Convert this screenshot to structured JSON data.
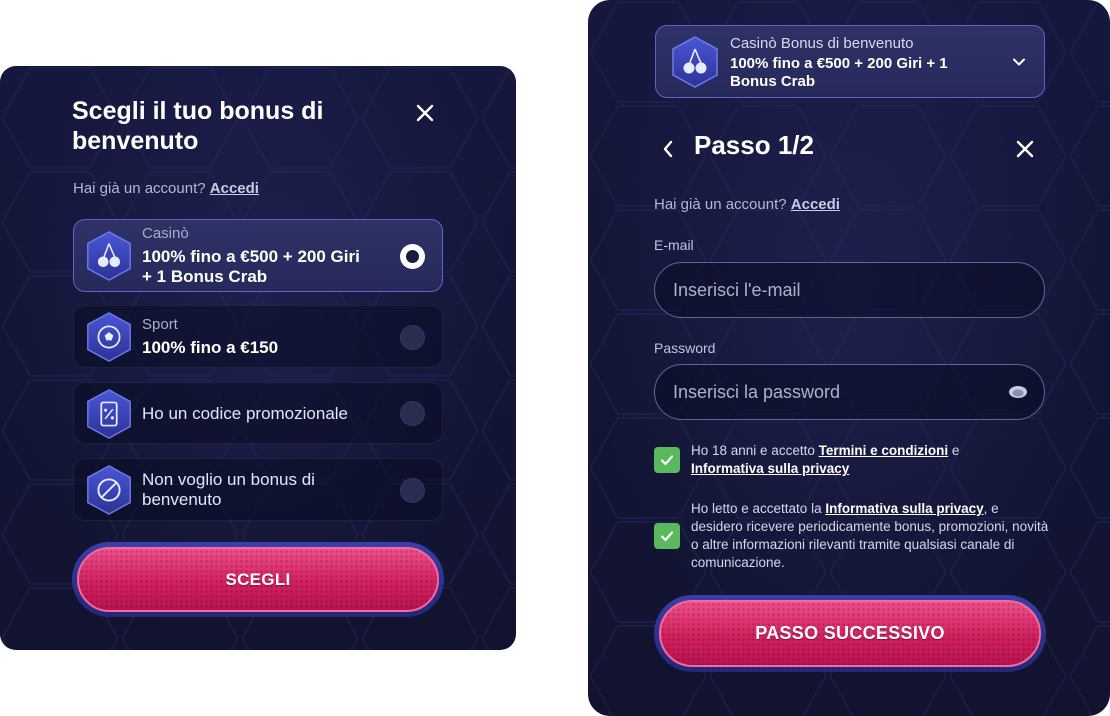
{
  "left": {
    "title": "Scegli il tuo bonus di benvenuto",
    "account_prompt": "Hai già un account?",
    "login_link": "Accedi",
    "options": [
      {
        "sub": "Casinò",
        "main": "100% fino a €500 + 200 Giri + 1 Bonus Crab",
        "icon": "cherry-icon",
        "selected": true
      },
      {
        "sub": "Sport",
        "main": "100% fino a €150",
        "icon": "soccer-ball-icon",
        "selected": false
      },
      {
        "text": "Ho un codice promozionale",
        "icon": "promo-code-icon",
        "selected": false
      },
      {
        "text": "Non voglio un bonus di benvenuto",
        "icon": "no-bonus-icon",
        "selected": false
      }
    ],
    "cta_label": "SCEGLI"
  },
  "right": {
    "bonus_selector": {
      "sub": "Casinò Bonus di benvenuto",
      "main": "100% fino a €500 + 200 Giri + 1 Bonus Crab"
    },
    "step_title": "Passo 1/2",
    "account_prompt": "Hai già un account?",
    "login_link": "Accedi",
    "email": {
      "label": "E-mail",
      "placeholder": "Inserisci l'e-mail",
      "value": ""
    },
    "password": {
      "label": "Password",
      "placeholder": "Inserisci la password",
      "value": ""
    },
    "consent_age": {
      "pre": "Ho 18 anni e accetto ",
      "link1": "Termini e condizioni",
      "mid": " e ",
      "link2": "Informativa sulla privacy",
      "checked": true
    },
    "consent_marketing": {
      "pre": "Ho letto e accettato la ",
      "link": "Informativa sulla privacy",
      "post": ", e desidero ricevere periodicamente bonus, promozioni, novità o altre informazioni rilevanti tramite qualsiasi canale di comunicazione.",
      "checked": true
    },
    "cta_label": "PASSO SUCCESSIVO"
  },
  "colors": {
    "panel_bg": "#13153a",
    "accent_border": "#5e63c9",
    "cta_pink": "#d2205f",
    "checkbox_green": "#5cb85c"
  }
}
